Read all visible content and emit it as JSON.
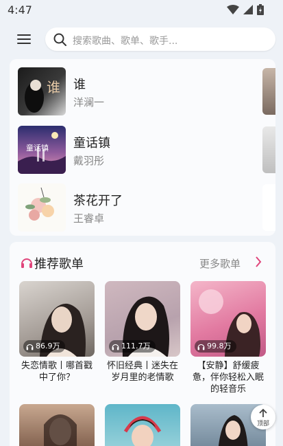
{
  "status_bar": {
    "time": "4:47"
  },
  "search": {
    "placeholder": "搜索歌曲、歌单、歌手..."
  },
  "songs": [
    {
      "title": "谁",
      "artist": "洋澜一"
    },
    {
      "title": "童话镇",
      "artist": "戴羽彤"
    },
    {
      "title": "茶花开了",
      "artist": "王睿卓"
    }
  ],
  "recommend": {
    "title": "推荐歌单",
    "more": "更多歌单",
    "playlists": [
      {
        "name": "失恋情歌丨哪首戳中了你？",
        "plays": "86.9万"
      },
      {
        "name": "怀旧经典丨迷失在岁月里的老情歌",
        "plays": "111.7万"
      },
      {
        "name": "【安静】舒缓疲惫，伴你轻松入眠的轻音乐",
        "plays": "99.8万"
      }
    ]
  },
  "back_to_top": {
    "label": "顶部"
  },
  "colors": {
    "accent": "#e0457b",
    "background": "#eef2f7"
  }
}
